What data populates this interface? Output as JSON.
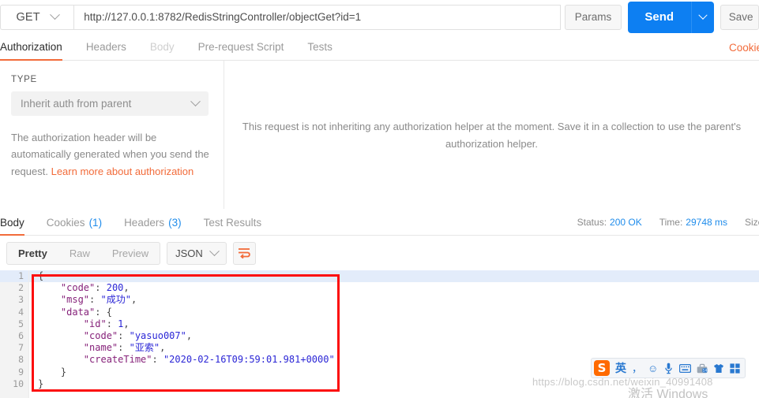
{
  "request": {
    "method": "GET",
    "url": "http://127.0.0.1:8782/RedisStringController/objectGet?id=1",
    "params_label": "Params",
    "send_label": "Send",
    "save_label": "Save",
    "tabs": [
      {
        "label": "Authorization",
        "state": "active"
      },
      {
        "label": "Headers",
        "state": "normal"
      },
      {
        "label": "Body",
        "state": "disabled"
      },
      {
        "label": "Pre-request Script",
        "state": "normal"
      },
      {
        "label": "Tests",
        "state": "normal"
      }
    ],
    "cookies_link": "Cookies"
  },
  "auth": {
    "type_label": "TYPE",
    "type_value": "Inherit auth from parent",
    "note_text": "The authorization header will be automatically generated when you send the request. ",
    "note_link": "Learn more about authorization",
    "message_line1": "This request is not inheriting any authorization helper at the moment. Save it in a collection to use the parent's",
    "message_line2": "authorization helper."
  },
  "response": {
    "tabs": [
      {
        "label": "Body",
        "count": "",
        "state": "active"
      },
      {
        "label": "Cookies",
        "count": "(1)",
        "state": "normal"
      },
      {
        "label": "Headers",
        "count": "(3)",
        "state": "normal"
      },
      {
        "label": "Test Results",
        "count": "",
        "state": "normal"
      }
    ],
    "status_label": "Status:",
    "status_value": "200 OK",
    "time_label": "Time:",
    "time_value": "29748 ms",
    "size_label": "Size"
  },
  "body_toolbar": {
    "pretty": "Pretty",
    "raw": "Raw",
    "preview": "Preview",
    "format": "JSON",
    "wrap_icon": "wrap-lines-icon"
  },
  "code": {
    "gutter": [
      "1",
      "2",
      "3",
      "4",
      "5",
      "6",
      "7",
      "8",
      "9",
      "10"
    ],
    "lines": [
      {
        "n": 1,
        "indent": 0,
        "tokens": [
          {
            "t": "{",
            "c": "p"
          }
        ]
      },
      {
        "n": 2,
        "indent": 1,
        "tokens": [
          {
            "t": "\"code\"",
            "c": "k"
          },
          {
            "t": ": ",
            "c": "p"
          },
          {
            "t": "200",
            "c": "n"
          },
          {
            "t": ",",
            "c": "p"
          }
        ]
      },
      {
        "n": 3,
        "indent": 1,
        "tokens": [
          {
            "t": "\"msg\"",
            "c": "k"
          },
          {
            "t": ": ",
            "c": "p"
          },
          {
            "t": "\"成功\"",
            "c": "s"
          },
          {
            "t": ",",
            "c": "p"
          }
        ]
      },
      {
        "n": 4,
        "indent": 1,
        "tokens": [
          {
            "t": "\"data\"",
            "c": "k"
          },
          {
            "t": ": {",
            "c": "p"
          }
        ]
      },
      {
        "n": 5,
        "indent": 2,
        "tokens": [
          {
            "t": "\"id\"",
            "c": "k"
          },
          {
            "t": ": ",
            "c": "p"
          },
          {
            "t": "1",
            "c": "n"
          },
          {
            "t": ",",
            "c": "p"
          }
        ]
      },
      {
        "n": 6,
        "indent": 2,
        "tokens": [
          {
            "t": "\"code\"",
            "c": "k"
          },
          {
            "t": ": ",
            "c": "p"
          },
          {
            "t": "\"yasuo007\"",
            "c": "s"
          },
          {
            "t": ",",
            "c": "p"
          }
        ]
      },
      {
        "n": 7,
        "indent": 2,
        "tokens": [
          {
            "t": "\"name\"",
            "c": "k"
          },
          {
            "t": ": ",
            "c": "p"
          },
          {
            "t": "\"亚索\"",
            "c": "s"
          },
          {
            "t": ",",
            "c": "p"
          }
        ]
      },
      {
        "n": 8,
        "indent": 2,
        "tokens": [
          {
            "t": "\"createTime\"",
            "c": "k"
          },
          {
            "t": ": ",
            "c": "p"
          },
          {
            "t": "\"2020-02-16T09:59:01.981+0000\"",
            "c": "s"
          }
        ]
      },
      {
        "n": 9,
        "indent": 1,
        "tokens": [
          {
            "t": "}",
            "c": "p"
          }
        ]
      },
      {
        "n": 10,
        "indent": 0,
        "tokens": [
          {
            "t": "}",
            "c": "p"
          }
        ]
      }
    ]
  },
  "annotations": {
    "highlight_rect_color": "#fc0d0d"
  },
  "watermarks": {
    "csdn": "https://blog.csdn.net/weixin_40991408",
    "windows_activation": "激活 Windows"
  },
  "ime": {
    "logo": "S",
    "items": [
      {
        "icon": "chinese-english-toggle-icon",
        "glyph": "英"
      },
      {
        "icon": "punctuation-toggle-icon",
        "glyph": "，"
      },
      {
        "icon": "emoji-icon",
        "glyph": "☺"
      },
      {
        "icon": "microphone-icon",
        "glyph": "🎤"
      },
      {
        "icon": "soft-keyboard-icon",
        "glyph": "⌨"
      },
      {
        "icon": "toolbox-icon",
        "glyph": "⚙"
      },
      {
        "icon": "skin-shirt-icon",
        "glyph": "👕"
      },
      {
        "icon": "apps-grid-icon",
        "glyph": "▦"
      }
    ]
  },
  "colors": {
    "accent_orange": "#f26b3a",
    "send_blue": "#0d7ff2",
    "link_blue": "#1f8ceb",
    "annotation_red": "#fc0d0d"
  }
}
